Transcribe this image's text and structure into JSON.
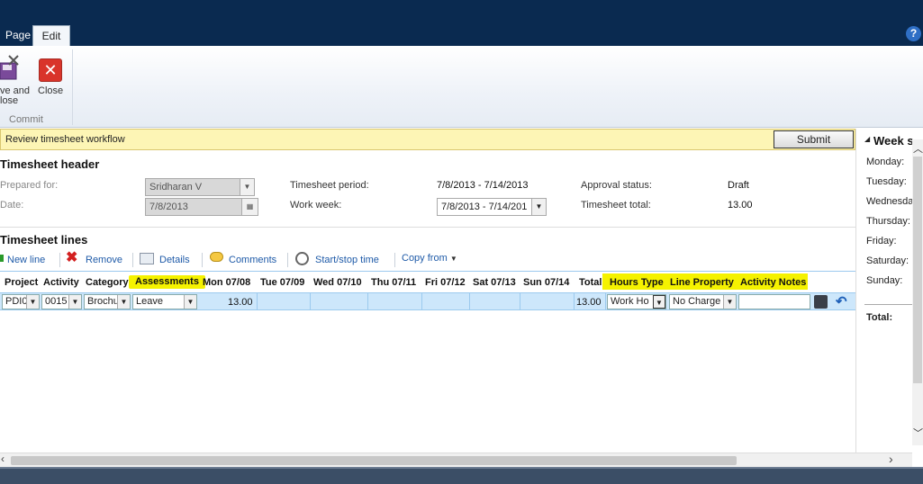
{
  "ribbon": {
    "tabs": [
      {
        "label": "Page"
      },
      {
        "label": "Edit"
      }
    ],
    "help_label": "?",
    "save_close_line1": "ve and",
    "save_close_line2": "lose",
    "close_label": "Close",
    "group_label": "Commit"
  },
  "workflow": {
    "text": "Review timesheet workflow",
    "submit_label": "Submit"
  },
  "header": {
    "title": "Timesheet header",
    "prepared_for_label": "Prepared for:",
    "prepared_for_value": "Sridharan V",
    "date_label": "Date:",
    "date_value": "7/8/2013",
    "period_label": "Timesheet period:",
    "period_value": "7/8/2013 - 7/14/2013",
    "work_week_label": "Work week:",
    "work_week_value": "7/8/2013 - 7/14/201",
    "approval_label": "Approval status:",
    "approval_value": "Draft",
    "total_label": "Timesheet total:",
    "total_value": "13.00"
  },
  "lines": {
    "title": "Timesheet lines",
    "toolbar": {
      "new_line": "New line",
      "remove": "Remove",
      "details": "Details",
      "comments": "Comments",
      "start_stop": "Start/stop time",
      "copy_from": "Copy from"
    },
    "columns": [
      "Project",
      "Activity",
      "Category",
      "Assessments",
      "Mon 07/08",
      "Tue 07/09",
      "Wed 07/10",
      "Thu 07/11",
      "Fri 07/12",
      "Sat 07/13",
      "Sun 07/14",
      "Total",
      "Hours Type",
      "Line Property",
      "Activity Notes"
    ],
    "row": {
      "project": "PDI0",
      "activity": "0015",
      "category": "Brochu",
      "assessment": "Leave",
      "mon": "13.00",
      "total": "13.00",
      "hours_type": "Work Ho",
      "line_property": "No Charge"
    }
  },
  "side": {
    "title": "Week s",
    "days": [
      "Monday:",
      "Tuesday:",
      "Wednesda",
      "Thursday:",
      "Friday:",
      "Saturday:",
      "Sunday:"
    ],
    "total_label": "Total:"
  }
}
